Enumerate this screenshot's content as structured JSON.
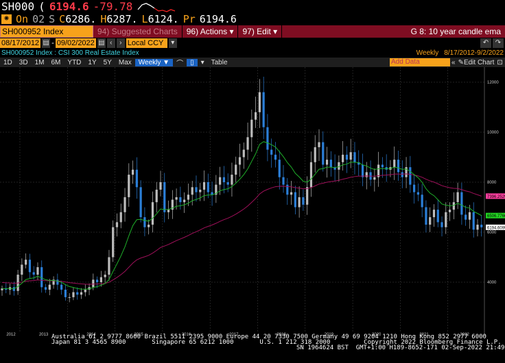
{
  "quote": {
    "ticker": "SH000",
    "paren": "(",
    "last": "6194.6",
    "change": "-79.78",
    "on_label": "On",
    "date": "02",
    "s_label": "S",
    "open_label": "C",
    "open": "6286.",
    "high_label": "H",
    "high": "6287.",
    "low_label": "L",
    "low": "6124.",
    "prev_label": "Pr",
    "prev": "6194.6"
  },
  "menubar": {
    "security": "SH000952 Index",
    "suggested": "94) Suggested Charts",
    "actions": "96) Actions ▾",
    "edit": "97) Edit ▾",
    "graph_title": "G 8: 10 year candle ema"
  },
  "daterow": {
    "start": "08/17/2012",
    "dash": "-",
    "end": "09/02/2022",
    "currency": "Local CCY",
    "period": "Weekly",
    "range": "8/17/2012-9/2/2022"
  },
  "chart_header": "SH000952 Index : CSI 300 Real Estate Index",
  "toolbar": {
    "ranges": [
      "1D",
      "3D",
      "1M",
      "6M",
      "YTD",
      "1Y",
      "5Y",
      "Max"
    ],
    "frequency": "Weekly ▼",
    "table": "Table",
    "add_data_placeholder": "Add Data",
    "edit_chart": "Edit Chart"
  },
  "colors": {
    "accent": "#f7a21b",
    "menubar": "#7f0d22",
    "up_candle": "#bdbdbd",
    "down_candle": "#2b7fd8",
    "ema_short": "#1fae2a",
    "ema_long": "#a0105a"
  },
  "chart_data": {
    "type": "candlestick",
    "frequency_shown": "monthly approximation of weekly candles",
    "x_start": "2012-08",
    "x_end": "2022-09",
    "xticks": [
      "2012",
      "2013",
      "2014",
      "2015",
      "2016",
      "2017",
      "2018",
      "2019",
      "2020",
      "2021",
      "2022"
    ],
    "yticks": [
      4000,
      6000,
      8000,
      10000,
      12000
    ],
    "ylim": [
      2000,
      12800
    ],
    "closes": [
      3750,
      3700,
      3800,
      3650,
      4300,
      4700,
      4900,
      4400,
      4300,
      4600,
      3800,
      3700,
      3900,
      4100,
      3900,
      3700,
      3400,
      3400,
      3600,
      3500,
      3600,
      3700,
      3800,
      4100,
      4000,
      4200,
      4300,
      5000,
      6200,
      6400,
      6800,
      7400,
      8300,
      8500,
      7800,
      6600,
      6200,
      6300,
      7200,
      7700,
      8000,
      6800,
      6900,
      7300,
      7400,
      7200,
      7300,
      7500,
      7800,
      7600,
      7700,
      8000,
      7600,
      7500,
      7900,
      8200,
      8000,
      7900,
      8300,
      8700,
      9000,
      9300,
      9800,
      10500,
      10800,
      11600,
      10200,
      9300,
      9100,
      8900,
      8200,
      7900,
      7500,
      7600,
      7000,
      7400,
      7100,
      7800,
      8800,
      9400,
      9600,
      8700,
      8900,
      8600,
      8500,
      8800,
      9100,
      8900,
      9200,
      8800,
      8700,
      8200,
      8400,
      8100,
      8200,
      8700,
      8600,
      8500,
      8600,
      8900,
      8400,
      8200,
      8600,
      7900,
      7600,
      7500,
      7000,
      6300,
      6600,
      6900,
      6400,
      6200,
      6800,
      6900,
      7200,
      7600,
      6700,
      6500,
      6800,
      6100,
      6300,
      6194.6
    ],
    "ema_periods_months": [
      12,
      46
    ],
    "last_value_labels": [
      {
        "series": "ema_long",
        "text": "7396.2529"
      },
      {
        "series": "ema_short",
        "text": "6506.7766"
      },
      {
        "series": "price",
        "text": "6194.6099"
      }
    ],
    "grid": true
  },
  "footer": {
    "line1": "Australia 61 2 9777 8600 Brazil 5511 2395 9000 Europe 44 20 7330 7500 Germany 49 69 9204 1210 Hong Kong 852 2977 6000",
    "line2": "Japan 81 3 4565 8900       Singapore 65 6212 1000       U.S. 1 212 318 2000         Copyright 2022 Bloomberg Finance L.P.",
    "line3": "SN 1964624 BST  GMT+1:00 H189-8652-171 02-Sep-2022 21:49:59"
  }
}
